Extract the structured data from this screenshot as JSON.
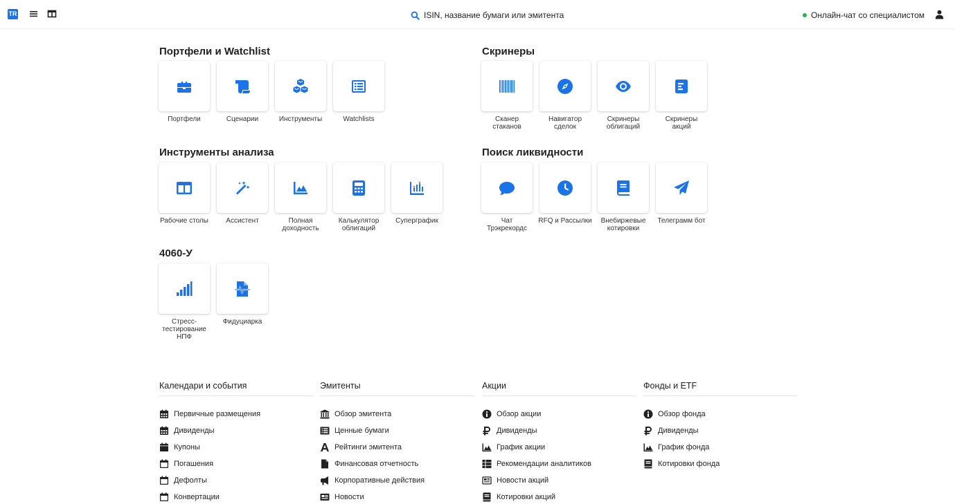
{
  "header": {
    "logo_text": "TR",
    "search_placeholder": "ISIN, название бумаги или эмитента",
    "chat_label": "Онлайн-чат со специалистом"
  },
  "sections": {
    "portfolios": {
      "title": "Портфели и Watchlist",
      "items": [
        {
          "label": "Портфели",
          "icon": "briefcase-icon"
        },
        {
          "label": "Сценарии",
          "icon": "scroll-icon"
        },
        {
          "label": "Инструменты",
          "icon": "cubes-icon"
        },
        {
          "label": "Watchlists",
          "icon": "list-alt-icon"
        }
      ]
    },
    "screeners": {
      "title": "Скринеры",
      "items": [
        {
          "label": "Сканер\nстаканов",
          "icon": "barcode-icon"
        },
        {
          "label": "Навигатор\nсделок",
          "icon": "compass-icon"
        },
        {
          "label": "Скринеры\nоблигаций",
          "icon": "eye-icon"
        },
        {
          "label": "Скринеры\nакций",
          "icon": "poll-h-icon"
        }
      ]
    },
    "analysis": {
      "title": "Инструменты анализа",
      "items": [
        {
          "label": "Рабочие столы",
          "icon": "columns-icon"
        },
        {
          "label": "Ассистент",
          "icon": "magic-icon"
        },
        {
          "label": "Полная\nдоходность",
          "icon": "area-chart-icon"
        },
        {
          "label": "Калькулятор\nоблигаций",
          "icon": "calculator-icon"
        },
        {
          "label": "Суперграфик",
          "icon": "chart-bars-icon"
        }
      ]
    },
    "liquidity": {
      "title": "Поиск ликвидности",
      "items": [
        {
          "label": "Чат\nТрэкрекордс",
          "icon": "comment-icon"
        },
        {
          "label": "RFQ и Рассылки",
          "icon": "clock-icon"
        },
        {
          "label": "Внебиржевые\nкотировки",
          "icon": "book-icon"
        },
        {
          "label": "Телеграмм бот",
          "icon": "paper-plane-icon"
        }
      ]
    },
    "form4060": {
      "title": "4060-У",
      "items": [
        {
          "label": "Стресс-\nтестирование\nНПФ",
          "icon": "signal-icon"
        },
        {
          "label": "Фидуциарка",
          "icon": "file-medical-icon"
        }
      ]
    }
  },
  "footer_columns": [
    {
      "title": "Календари и события",
      "links": [
        {
          "label": "Первичные размещения",
          "icon": "calendar-grid-icon"
        },
        {
          "label": "Дивиденды",
          "icon": "calendar-grid-icon"
        },
        {
          "label": "Купоны",
          "icon": "calendar-filled-icon"
        },
        {
          "label": "Погашения",
          "icon": "calendar-outline-icon"
        },
        {
          "label": "Дефолты",
          "icon": "calendar-outline-icon"
        },
        {
          "label": "Конвертации",
          "icon": "calendar-outline-icon"
        }
      ]
    },
    {
      "title": "Эмитенты",
      "links": [
        {
          "label": "Обзор эмитента",
          "icon": "landmark-icon"
        },
        {
          "label": "Ценные бумаги",
          "icon": "list-box-icon"
        },
        {
          "label": "Рейтинги эмитента",
          "icon": "font-a-icon"
        },
        {
          "label": "Финансовая отчетность",
          "icon": "file-icon"
        },
        {
          "label": "Корпоративные действия",
          "icon": "megaphone-icon"
        },
        {
          "label": "Новости",
          "icon": "newspaper-icon"
        }
      ]
    },
    {
      "title": "Акции",
      "links": [
        {
          "label": "Обзор акции",
          "icon": "info-circle-icon"
        },
        {
          "label": "Дивиденды",
          "icon": "ruble-icon"
        },
        {
          "label": "График акции",
          "icon": "area-chart-icon"
        },
        {
          "label": "Рекомендации аналитиков",
          "icon": "table-list-icon"
        },
        {
          "label": "Новости акций",
          "icon": "newspaper-outline-icon"
        },
        {
          "label": "Котировки акций",
          "icon": "book-icon"
        }
      ]
    },
    {
      "title": "Фонды и ETF",
      "links": [
        {
          "label": "Обзор фонда",
          "icon": "info-circle-icon"
        },
        {
          "label": "Дивиденды",
          "icon": "ruble-icon"
        },
        {
          "label": "График фонда",
          "icon": "area-chart-icon"
        },
        {
          "label": "Котировки фонда",
          "icon": "book-icon"
        }
      ]
    }
  ],
  "colors": {
    "accent": "#1a73e8",
    "status_online": "#2bb24c",
    "icon_dark": "#222222"
  }
}
